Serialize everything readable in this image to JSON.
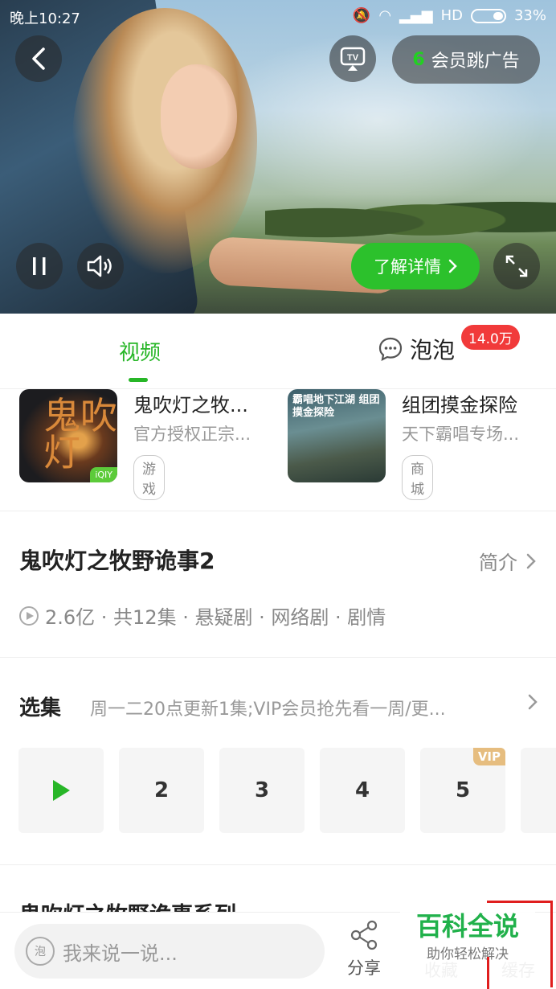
{
  "status_bar": {
    "time": "晚上10:27",
    "network": "HD",
    "battery": "33%"
  },
  "player": {
    "vip_skip_count": "6",
    "vip_skip_label": "会员跳广告",
    "learn_more_label": "了解详情"
  },
  "tabs": {
    "video": "视频",
    "bubble": "泡泡",
    "bubble_count": "14.0万"
  },
  "promos": [
    {
      "title": "鬼吹灯之牧...",
      "subtitle": "官方授权正宗...",
      "tag": "游戏",
      "thumb_text": "鬼吹灯",
      "thumb_badge": "iQIY"
    },
    {
      "title": "组团摸金探险",
      "subtitle": "天下霸唱专场...",
      "tag": "商城",
      "thumb_text": "霸唱地下江湖 组团摸金探险"
    }
  ],
  "show": {
    "title": "鬼吹灯之牧野诡事2",
    "intro_label": "简介",
    "meta": "2.6亿 · 共12集 · 悬疑剧 · 网络剧 · 剧情"
  },
  "episodes": {
    "heading": "选集",
    "note": "周一二20点更新1集;VIP会员抢先看一周/更...",
    "items": [
      "2",
      "3",
      "4",
      "5"
    ],
    "vip_badge": "VIP"
  },
  "series_heading": "鬼吹灯之牧野诡事系列",
  "bottom_bar": {
    "comment_placeholder": "我来说一说...",
    "comment_icon_text": "泡",
    "share": "分享",
    "collect": "收藏",
    "cache": "缓存"
  },
  "watermark": {
    "big": "百科全说",
    "small": "助你轻松解决"
  },
  "colors": {
    "accent_green": "#27b627",
    "badge_red": "#f13a3a",
    "vip_gold": "#e6bd7f"
  }
}
